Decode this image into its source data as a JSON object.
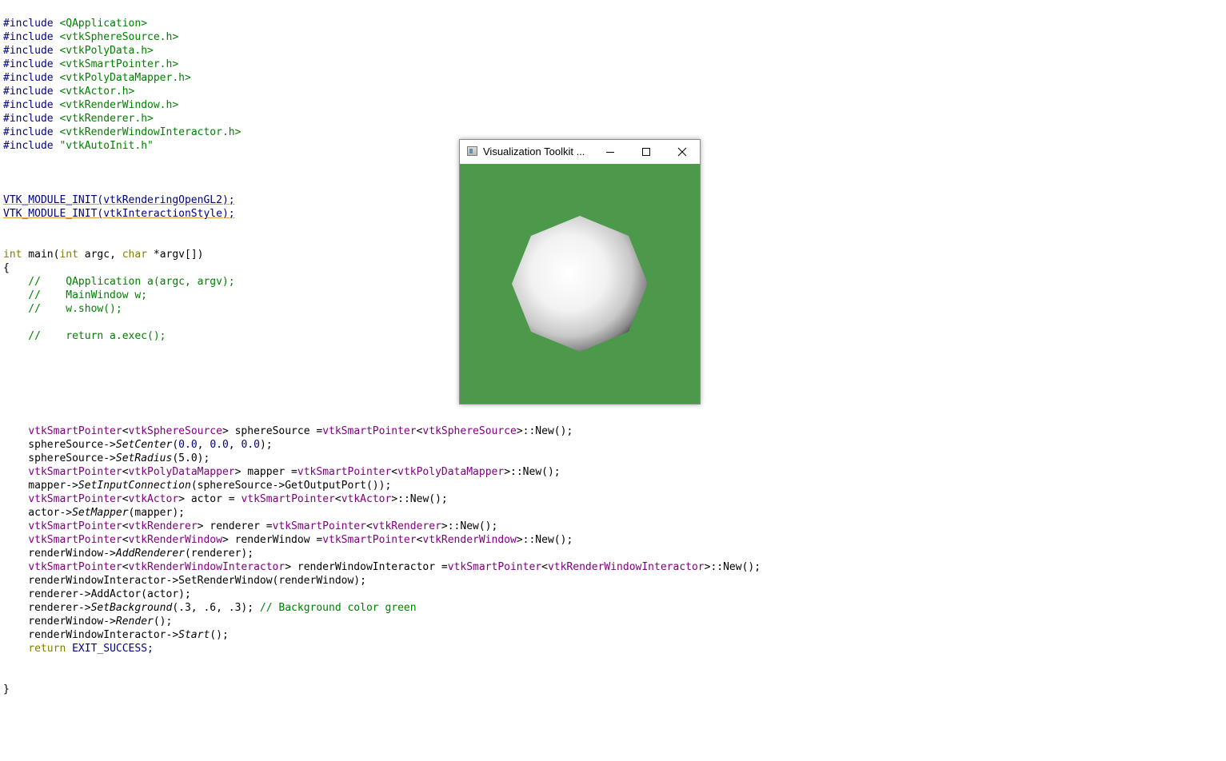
{
  "window": {
    "title": "Visualization Toolkit ...",
    "background_color": "#4c994c",
    "icons": [
      "app-icon",
      "minimize-icon",
      "maximize-icon",
      "close-icon"
    ]
  },
  "code_lines": [
    {
      "segments": [
        {
          "t": "#include ",
          "c": "kw-pp"
        },
        {
          "t": "<QApplication>",
          "c": "str"
        }
      ]
    },
    {
      "segments": [
        {
          "t": "#include ",
          "c": "kw-pp"
        },
        {
          "t": "<vtkSphereSource.h>",
          "c": "str"
        }
      ]
    },
    {
      "segments": [
        {
          "t": "#include ",
          "c": "kw-pp"
        },
        {
          "t": "<vtkPolyData.h>",
          "c": "str"
        }
      ]
    },
    {
      "segments": [
        {
          "t": "#include ",
          "c": "kw-pp"
        },
        {
          "t": "<vtkSmartPointer.h>",
          "c": "str"
        }
      ]
    },
    {
      "segments": [
        {
          "t": "#include ",
          "c": "kw-pp"
        },
        {
          "t": "<vtkPolyDataMapper.h>",
          "c": "str"
        }
      ]
    },
    {
      "segments": [
        {
          "t": "#include ",
          "c": "kw-pp"
        },
        {
          "t": "<vtkActor.h>",
          "c": "str"
        }
      ]
    },
    {
      "segments": [
        {
          "t": "#include ",
          "c": "kw-pp"
        },
        {
          "t": "<vtkRenderWindow.h>",
          "c": "str"
        }
      ]
    },
    {
      "segments": [
        {
          "t": "#include ",
          "c": "kw-pp"
        },
        {
          "t": "<vtkRenderer.h>",
          "c": "str"
        }
      ]
    },
    {
      "segments": [
        {
          "t": "#include ",
          "c": "kw-pp"
        },
        {
          "t": "<vtkRenderWindowInteractor.h>",
          "c": "str"
        }
      ]
    },
    {
      "segments": [
        {
          "t": "#include ",
          "c": "kw-pp"
        },
        {
          "t": "\"vtkAutoInit.h\"",
          "c": "str"
        }
      ]
    },
    {
      "segments": []
    },
    {
      "segments": []
    },
    {
      "segments": []
    },
    {
      "segments": [
        {
          "t": "VTK_MODULE_INIT",
          "c": "macro"
        },
        {
          "t": "(vtkRenderingOpenGL2);",
          "c": "macro"
        }
      ]
    },
    {
      "segments": [
        {
          "t": "VTK_MODULE_INIT",
          "c": "macro"
        },
        {
          "t": "(vtkInteractionStyle);",
          "c": "macro"
        }
      ]
    },
    {
      "segments": []
    },
    {
      "segments": []
    },
    {
      "segments": [
        {
          "t": "int",
          "c": "kw"
        },
        {
          "t": " main(",
          "c": ""
        },
        {
          "t": "int",
          "c": "kw"
        },
        {
          "t": " argc, ",
          "c": ""
        },
        {
          "t": "char",
          "c": "kw"
        },
        {
          "t": " *argv[])",
          "c": ""
        }
      ]
    },
    {
      "segments": [
        {
          "t": "{",
          "c": ""
        }
      ]
    },
    {
      "segments": [
        {
          "t": "    //    QApplication a(argc, argv);",
          "c": "cmt"
        }
      ]
    },
    {
      "segments": [
        {
          "t": "    //    MainWindow w;",
          "c": "cmt"
        }
      ]
    },
    {
      "segments": [
        {
          "t": "    //    w.show();",
          "c": "cmt"
        }
      ]
    },
    {
      "segments": []
    },
    {
      "segments": [
        {
          "t": "    //    return a.exec();",
          "c": "cmt"
        }
      ]
    },
    {
      "segments": []
    },
    {
      "segments": []
    },
    {
      "segments": []
    },
    {
      "segments": []
    },
    {
      "segments": []
    },
    {
      "segments": []
    },
    {
      "segments": [
        {
          "t": "    ",
          "c": ""
        },
        {
          "t": "vtkSmartPointer",
          "c": "tpl"
        },
        {
          "t": "<",
          "c": ""
        },
        {
          "t": "vtkSphereSource",
          "c": "tpl"
        },
        {
          "t": "> sphereSource =",
          "c": ""
        },
        {
          "t": "vtkSmartPointer",
          "c": "tpl"
        },
        {
          "t": "<",
          "c": ""
        },
        {
          "t": "vtkSphereSource",
          "c": "tpl"
        },
        {
          "t": ">::New();",
          "c": ""
        }
      ]
    },
    {
      "segments": [
        {
          "t": "    sphereSource->",
          "c": ""
        },
        {
          "t": "SetCenter",
          "c": "fn"
        },
        {
          "t": "(",
          "c": ""
        },
        {
          "t": "0.0",
          "c": "num"
        },
        {
          "t": ", ",
          "c": ""
        },
        {
          "t": "0.0",
          "c": "num"
        },
        {
          "t": ", ",
          "c": ""
        },
        {
          "t": "0.0",
          "c": "num"
        },
        {
          "t": ");",
          "c": ""
        }
      ]
    },
    {
      "segments": [
        {
          "t": "    sphereSource->",
          "c": ""
        },
        {
          "t": "SetRadius",
          "c": "fn"
        },
        {
          "t": "(5.0);",
          "c": ""
        }
      ]
    },
    {
      "segments": [
        {
          "t": "    ",
          "c": ""
        },
        {
          "t": "vtkSmartPointer",
          "c": "tpl"
        },
        {
          "t": "<",
          "c": ""
        },
        {
          "t": "vtkPolyDataMapper",
          "c": "tpl"
        },
        {
          "t": "> mapper =",
          "c": ""
        },
        {
          "t": "vtkSmartPointer",
          "c": "tpl"
        },
        {
          "t": "<",
          "c": ""
        },
        {
          "t": "vtkPolyDataMapper",
          "c": "tpl"
        },
        {
          "t": ">::New();",
          "c": ""
        }
      ]
    },
    {
      "segments": [
        {
          "t": "    mapper->",
          "c": ""
        },
        {
          "t": "SetInputConnection",
          "c": "fn"
        },
        {
          "t": "(sphereSource->GetOutputPort());",
          "c": ""
        }
      ]
    },
    {
      "segments": [
        {
          "t": "    ",
          "c": ""
        },
        {
          "t": "vtkSmartPointer",
          "c": "tpl"
        },
        {
          "t": "<",
          "c": ""
        },
        {
          "t": "vtkActor",
          "c": "tpl"
        },
        {
          "t": "> actor = ",
          "c": ""
        },
        {
          "t": "vtkSmartPointer",
          "c": "tpl"
        },
        {
          "t": "<",
          "c": ""
        },
        {
          "t": "vtkActor",
          "c": "tpl"
        },
        {
          "t": ">::New();",
          "c": ""
        }
      ]
    },
    {
      "segments": [
        {
          "t": "    actor->",
          "c": ""
        },
        {
          "t": "SetMapper",
          "c": "fn"
        },
        {
          "t": "(mapper);",
          "c": ""
        }
      ]
    },
    {
      "segments": [
        {
          "t": "    ",
          "c": ""
        },
        {
          "t": "vtkSmartPointer",
          "c": "tpl"
        },
        {
          "t": "<",
          "c": ""
        },
        {
          "t": "vtkRenderer",
          "c": "tpl"
        },
        {
          "t": "> renderer =",
          "c": ""
        },
        {
          "t": "vtkSmartPointer",
          "c": "tpl"
        },
        {
          "t": "<",
          "c": ""
        },
        {
          "t": "vtkRenderer",
          "c": "tpl"
        },
        {
          "t": ">::New();",
          "c": ""
        }
      ]
    },
    {
      "segments": [
        {
          "t": "    ",
          "c": ""
        },
        {
          "t": "vtkSmartPointer",
          "c": "tpl"
        },
        {
          "t": "<",
          "c": ""
        },
        {
          "t": "vtkRenderWindow",
          "c": "tpl"
        },
        {
          "t": "> renderWindow =",
          "c": ""
        },
        {
          "t": "vtkSmartPointer",
          "c": "tpl"
        },
        {
          "t": "<",
          "c": ""
        },
        {
          "t": "vtkRenderWindow",
          "c": "tpl"
        },
        {
          "t": ">::New();",
          "c": ""
        }
      ]
    },
    {
      "segments": [
        {
          "t": "    renderWindow->",
          "c": ""
        },
        {
          "t": "AddRenderer",
          "c": "fn"
        },
        {
          "t": "(renderer);",
          "c": ""
        }
      ]
    },
    {
      "segments": [
        {
          "t": "    ",
          "c": ""
        },
        {
          "t": "vtkSmartPointer",
          "c": "tpl"
        },
        {
          "t": "<",
          "c": ""
        },
        {
          "t": "vtkRenderWindowInteractor",
          "c": "tpl"
        },
        {
          "t": "> renderWindowInteractor =",
          "c": ""
        },
        {
          "t": "vtkSmartPointer",
          "c": "tpl"
        },
        {
          "t": "<",
          "c": ""
        },
        {
          "t": "vtkRenderWindowInteractor",
          "c": "tpl"
        },
        {
          "t": ">::New();",
          "c": ""
        }
      ]
    },
    {
      "segments": [
        {
          "t": "    renderWindowInteractor->SetRenderWindow(renderWindow);",
          "c": ""
        }
      ]
    },
    {
      "segments": [
        {
          "t": "    renderer->AddActor(actor);",
          "c": ""
        }
      ]
    },
    {
      "segments": [
        {
          "t": "    renderer->",
          "c": ""
        },
        {
          "t": "SetBackground",
          "c": "fn"
        },
        {
          "t": "(.3, .6, .3); ",
          "c": ""
        },
        {
          "t": "// Background color green",
          "c": "cmt"
        }
      ]
    },
    {
      "segments": [
        {
          "t": "    renderWindow->",
          "c": ""
        },
        {
          "t": "Render",
          "c": "fn"
        },
        {
          "t": "();",
          "c": ""
        }
      ]
    },
    {
      "segments": [
        {
          "t": "    renderWindowInteractor->",
          "c": ""
        },
        {
          "t": "Start",
          "c": "fn"
        },
        {
          "t": "();",
          "c": ""
        }
      ]
    },
    {
      "segments": [
        {
          "t": "    ",
          "c": ""
        },
        {
          "t": "return",
          "c": "kw"
        },
        {
          "t": " EXIT_SUCCESS;",
          "c": "kw-pp"
        }
      ]
    },
    {
      "segments": []
    },
    {
      "segments": []
    },
    {
      "segments": [
        {
          "t": "}",
          "c": ""
        }
      ]
    }
  ]
}
